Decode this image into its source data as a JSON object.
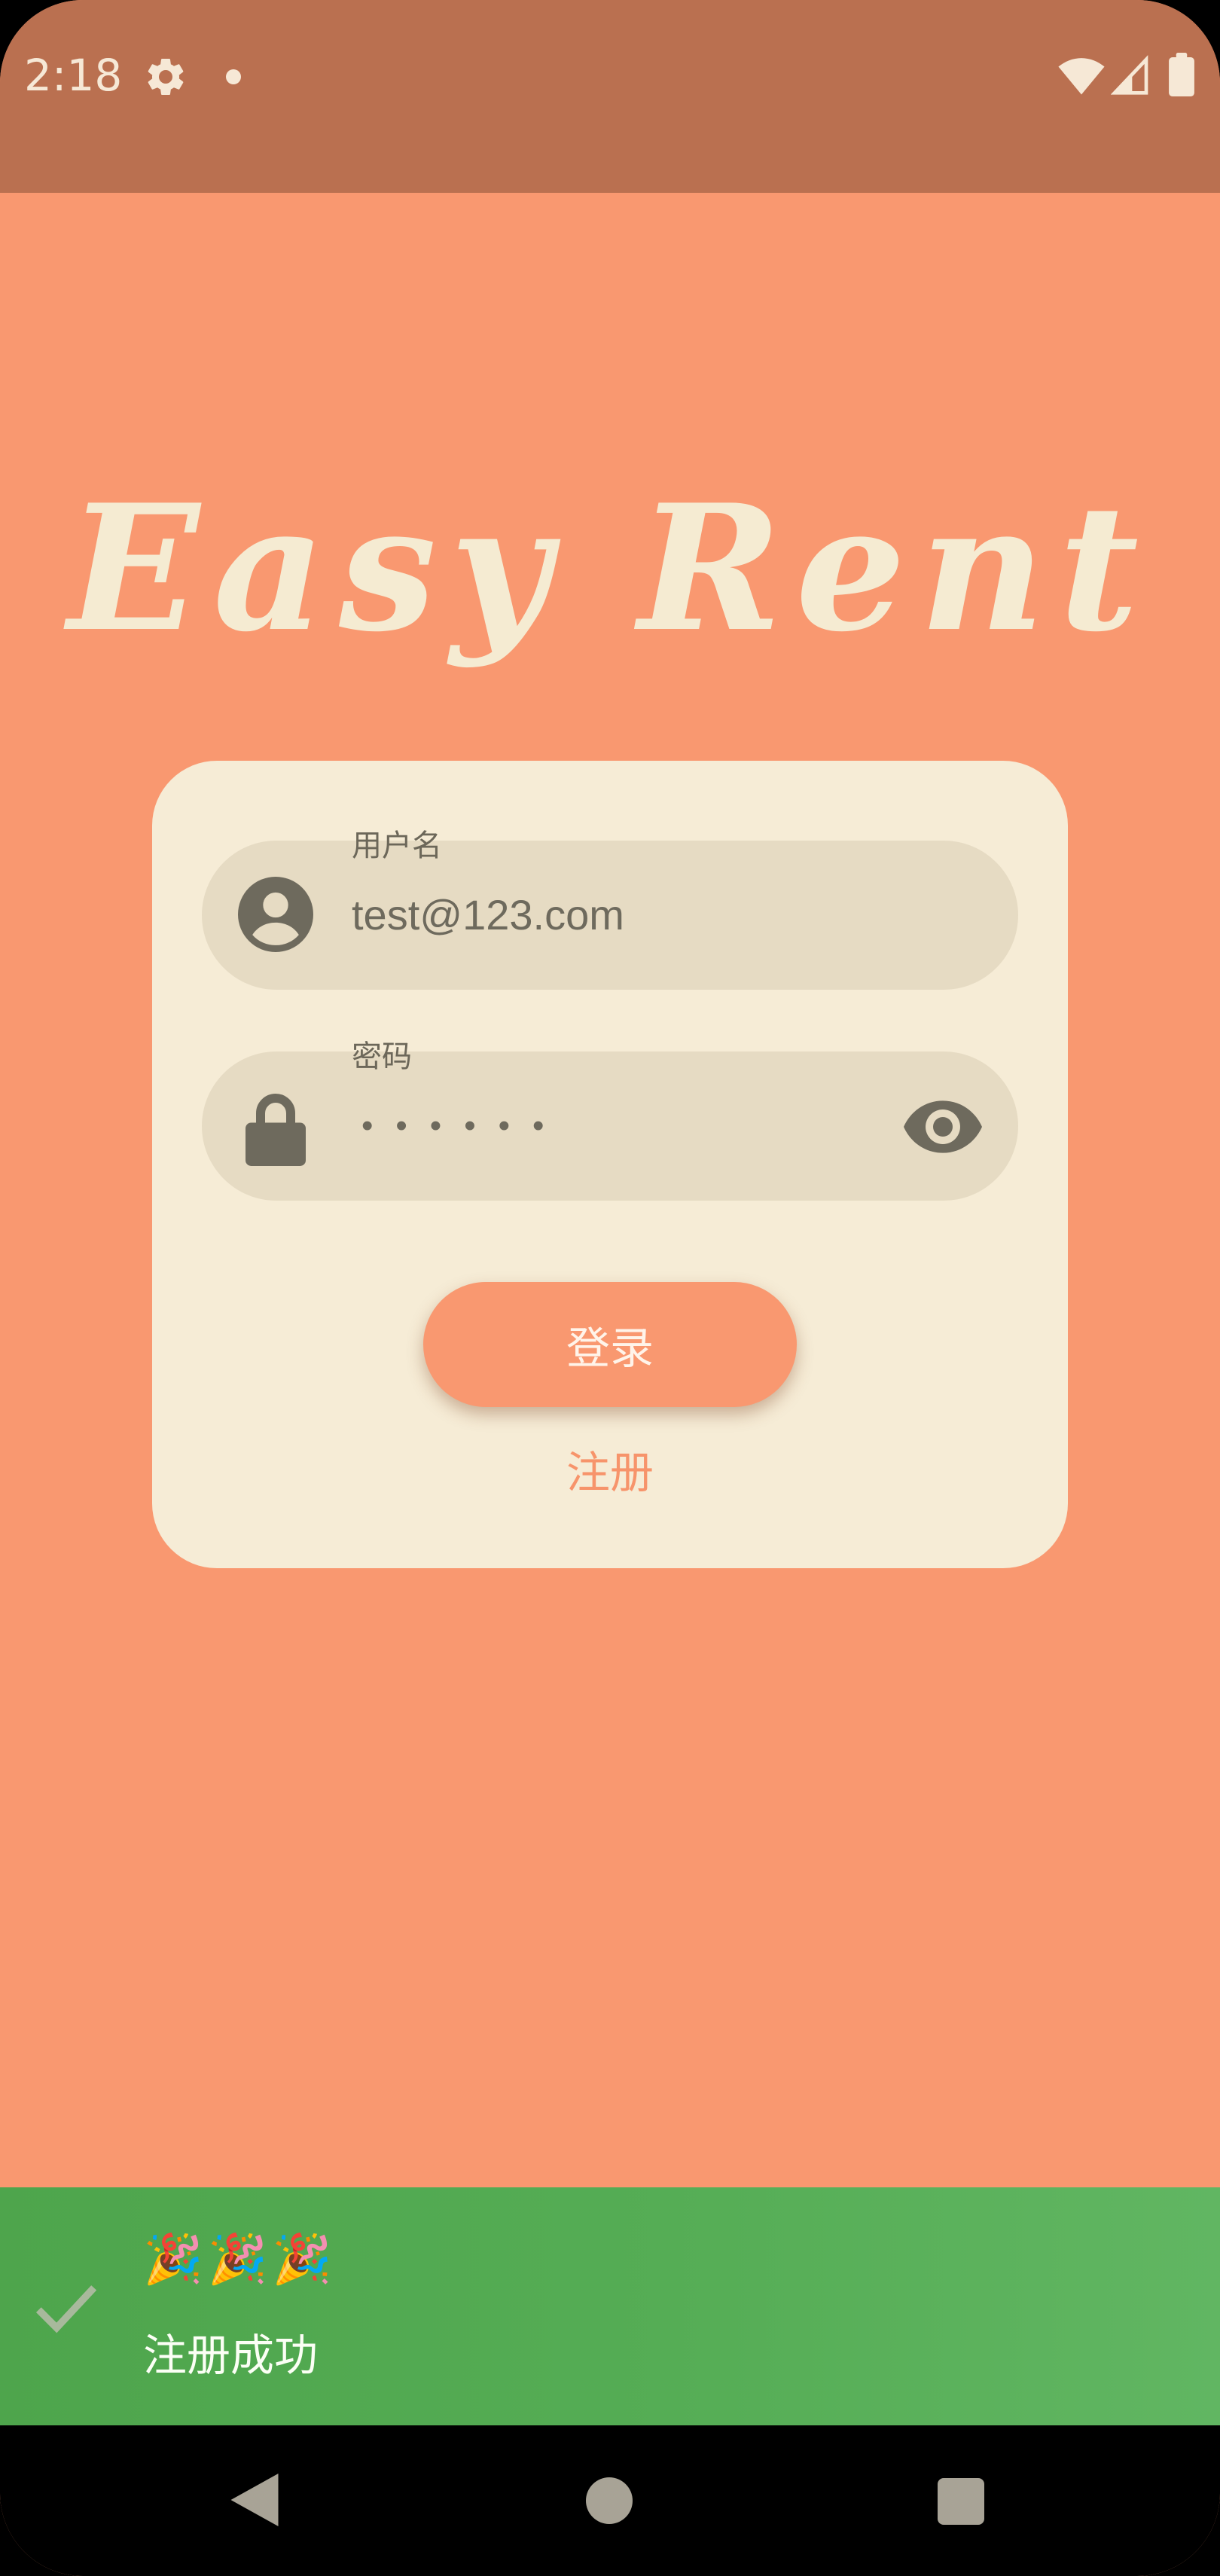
{
  "status_bar": {
    "time": "2:18",
    "icons": [
      "gear-icon",
      "dot-icon",
      "wifi-icon",
      "signal-icon",
      "battery-icon"
    ]
  },
  "app": {
    "logo": "Easy Rent"
  },
  "login_form": {
    "username": {
      "label": "用户名",
      "value": "test@123.com",
      "icon": "user-icon"
    },
    "password": {
      "label": "密码",
      "masked_value": "••••••",
      "icon": "lock-icon",
      "toggle_icon": "eye-icon"
    },
    "login_button": "登录",
    "register_link": "注册"
  },
  "snackbar": {
    "emoji": "🎉🎉🎉",
    "message": "注册成功",
    "icon": "check-icon"
  },
  "nav_bar": {
    "icons": [
      "back-icon",
      "home-icon",
      "recents-icon"
    ]
  },
  "colors": {
    "background": "#f99870",
    "status_bar": "#ba7050",
    "card": "#f6ecd6",
    "field": "#e6dbc3",
    "accent": "#f99870",
    "snackbar": "#55ad55"
  }
}
